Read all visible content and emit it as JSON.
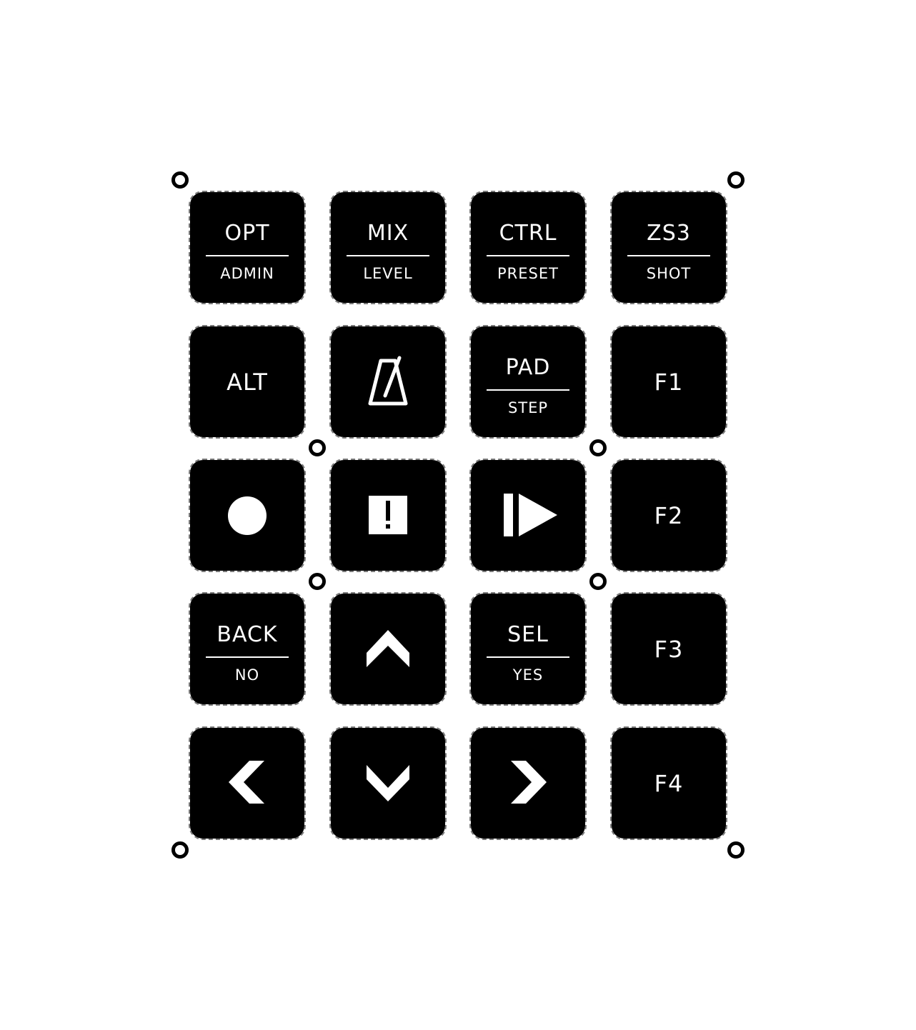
{
  "keypad": {
    "row1": {
      "opt": {
        "top": "OPT",
        "bottom": "ADMIN"
      },
      "mix": {
        "top": "MIX",
        "bottom": "LEVEL"
      },
      "ctrl": {
        "top": "CTRL",
        "bottom": "PRESET"
      },
      "zs3": {
        "top": "ZS3",
        "bottom": "SHOT"
      }
    },
    "row2": {
      "alt": "ALT",
      "metronome_icon": "metronome-icon",
      "pad": {
        "top": "PAD",
        "bottom": "STEP"
      },
      "f1": "F1"
    },
    "row3": {
      "record_icon": "record-icon",
      "alert_icon": "exclamation-icon",
      "play_icon": "play-from-start-icon",
      "f2": "F2"
    },
    "row4": {
      "back": {
        "top": "BACK",
        "bottom": "NO"
      },
      "up_icon": "chevron-up-icon",
      "sel": {
        "top": "SEL",
        "bottom": "YES"
      },
      "f3": "F3"
    },
    "row5": {
      "left_icon": "chevron-left-icon",
      "down_icon": "chevron-down-icon",
      "right_icon": "chevron-right-icon",
      "f4": "F4"
    }
  },
  "colors": {
    "key_fill": "#000000",
    "key_text": "#ffffff",
    "outline": "#7a7a7a",
    "background": "#ffffff"
  }
}
